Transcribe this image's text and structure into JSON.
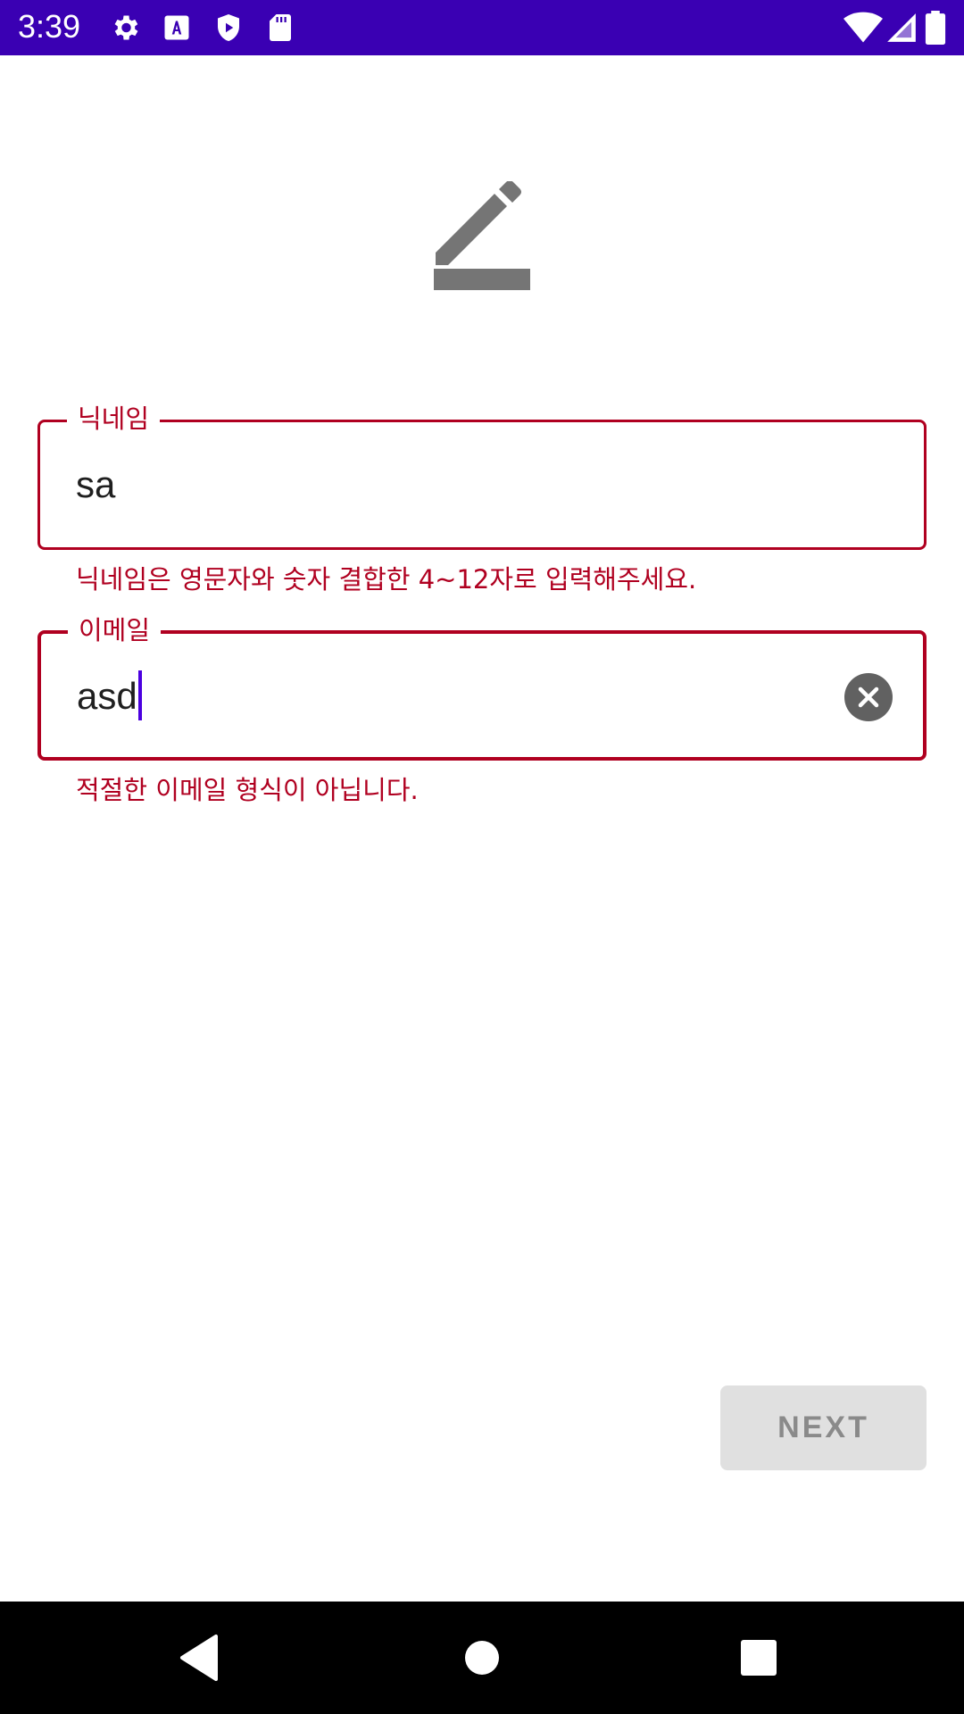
{
  "status_bar": {
    "time": "3:39",
    "background": "#3a00b3",
    "left_icons": [
      "settings-gear-icon",
      "font-a-icon",
      "play-shield-icon",
      "sd-card-icon"
    ],
    "right_icons": [
      "wifi-icon",
      "cellular-signal-icon",
      "battery-icon"
    ]
  },
  "header": {
    "icon": "edit-pencil-icon"
  },
  "form": {
    "nickname": {
      "label": "닉네임",
      "value": "sa",
      "error": "닉네임은 영문자와 숫자 결합한 4~12자로 입력해주세요."
    },
    "email": {
      "label": "이메일",
      "value": "asd",
      "error": "적절한 이메일 형식이 아닙니다.",
      "clear_icon": "clear-circle-icon"
    },
    "error_color": "#b00020"
  },
  "actions": {
    "next_label": "NEXT"
  },
  "nav_bar": {
    "items": [
      "back-triangle-icon",
      "home-circle-icon",
      "recents-square-icon"
    ]
  }
}
